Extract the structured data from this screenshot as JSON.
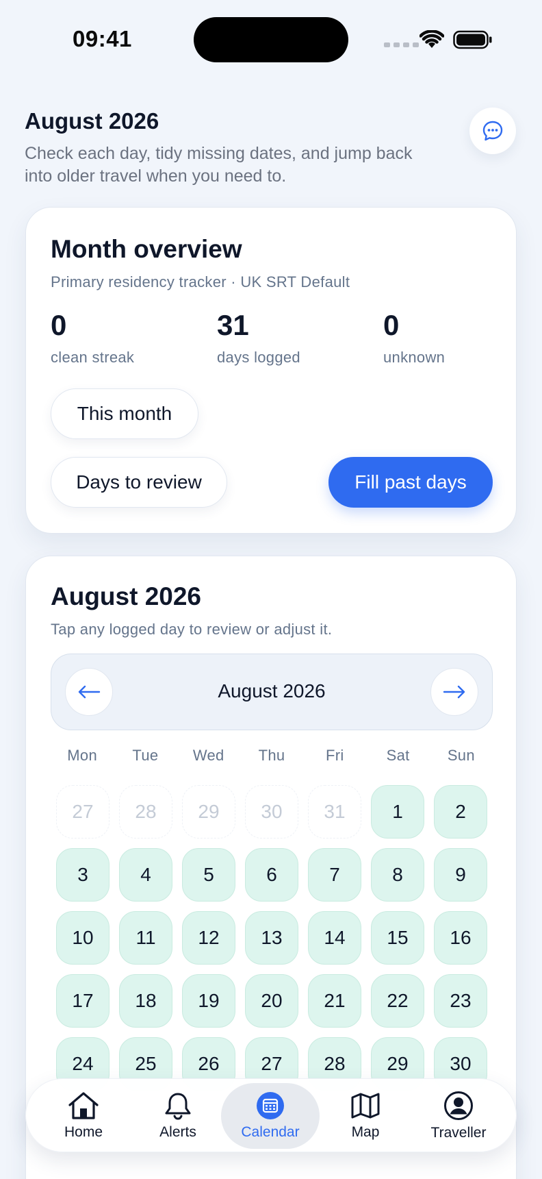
{
  "status_bar": {
    "time": "09:41"
  },
  "header": {
    "title": "August 2026",
    "subtitle": "Check each day, tidy missing dates, and jump back into older travel when you need to."
  },
  "overview": {
    "title": "Month overview",
    "subtitle": "Primary residency tracker · UK SRT Default",
    "stats": [
      {
        "value": "0",
        "label": "clean streak"
      },
      {
        "value": "31",
        "label": "days logged"
      },
      {
        "value": "0",
        "label": "unknown"
      }
    ],
    "buttons": {
      "this_month": "This month",
      "days_to_review": "Days to review",
      "fill_past_days": "Fill past days"
    }
  },
  "calendar": {
    "title": "August 2026",
    "subtitle": "Tap any logged day to review or adjust it.",
    "nav": {
      "label": "August 2026",
      "prev_icon": "arrow-left-icon",
      "next_icon": "arrow-right-icon"
    },
    "weekdays": [
      "Mon",
      "Tue",
      "Wed",
      "Thu",
      "Fri",
      "Sat",
      "Sun"
    ],
    "days": [
      {
        "n": "27",
        "state": "outside"
      },
      {
        "n": "28",
        "state": "outside"
      },
      {
        "n": "29",
        "state": "outside"
      },
      {
        "n": "30",
        "state": "outside"
      },
      {
        "n": "31",
        "state": "outside"
      },
      {
        "n": "1",
        "state": "logged"
      },
      {
        "n": "2",
        "state": "logged"
      },
      {
        "n": "3",
        "state": "logged"
      },
      {
        "n": "4",
        "state": "logged"
      },
      {
        "n": "5",
        "state": "logged"
      },
      {
        "n": "6",
        "state": "logged"
      },
      {
        "n": "7",
        "state": "logged"
      },
      {
        "n": "8",
        "state": "logged"
      },
      {
        "n": "9",
        "state": "logged"
      },
      {
        "n": "10",
        "state": "logged"
      },
      {
        "n": "11",
        "state": "logged"
      },
      {
        "n": "12",
        "state": "logged"
      },
      {
        "n": "13",
        "state": "logged"
      },
      {
        "n": "14",
        "state": "logged"
      },
      {
        "n": "15",
        "state": "logged"
      },
      {
        "n": "16",
        "state": "logged"
      },
      {
        "n": "17",
        "state": "logged"
      },
      {
        "n": "18",
        "state": "logged"
      },
      {
        "n": "19",
        "state": "logged"
      },
      {
        "n": "20",
        "state": "logged"
      },
      {
        "n": "21",
        "state": "logged"
      },
      {
        "n": "22",
        "state": "logged"
      },
      {
        "n": "23",
        "state": "logged"
      },
      {
        "n": "24",
        "state": "logged"
      },
      {
        "n": "25",
        "state": "logged"
      },
      {
        "n": "26",
        "state": "logged"
      },
      {
        "n": "27",
        "state": "logged"
      },
      {
        "n": "28",
        "state": "logged"
      },
      {
        "n": "29",
        "state": "logged"
      },
      {
        "n": "30",
        "state": "logged"
      }
    ]
  },
  "tab_bar": {
    "active": "Calendar",
    "tabs": [
      {
        "label": "Home",
        "icon": "home-icon"
      },
      {
        "label": "Alerts",
        "icon": "bell-icon"
      },
      {
        "label": "Calendar",
        "icon": "calendar-icon"
      },
      {
        "label": "Map",
        "icon": "map-icon"
      },
      {
        "label": "Traveller",
        "icon": "user-circle-icon"
      }
    ]
  },
  "colors": {
    "accent": "#2f6bf0",
    "logged_day_bg": "#ddf5ee",
    "background": "#f1f5fb"
  }
}
